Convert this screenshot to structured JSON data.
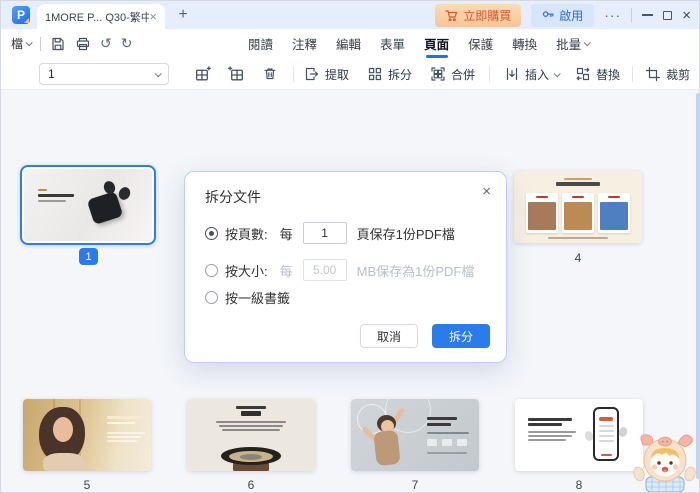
{
  "titlebar": {
    "tab_title": "1MORE P... Q30-繁中",
    "buy_label": "立即購買",
    "activate_label": "啟用"
  },
  "menubar": {
    "file_label": "檔",
    "tabs": [
      "閱讀",
      "注釋",
      "編輯",
      "表單",
      "頁面",
      "保護",
      "轉換",
      "批量"
    ],
    "active_tab": "頁面"
  },
  "toolbar": {
    "page_value": "1",
    "extract_label": "提取",
    "split_label": "拆分",
    "merge_label": "合併",
    "insert_label": "插入",
    "replace_label": "替換",
    "crop_label": "裁剪"
  },
  "dialog": {
    "title": "拆分文件",
    "option_pages": {
      "label": "按頁數:",
      "every": "每",
      "value": "1",
      "suffix": "頁保存1份PDF檔",
      "selected": true
    },
    "option_size": {
      "label": "按大小:",
      "every": "每",
      "value": "5.00",
      "suffix": "MB保存為1份PDF檔",
      "selected": false
    },
    "option_bookmark": {
      "label": "按一級書籤",
      "selected": false
    },
    "cancel_label": "取消",
    "confirm_label": "拆分"
  },
  "thumbnails": {
    "selected_page": "1",
    "page4": "4",
    "page5": "5",
    "page6": "6",
    "page7": "7",
    "page8": "8"
  },
  "glyphs": {
    "tab_close": "×",
    "new_tab": "+",
    "more": "···",
    "window_close": "×",
    "dialog_close": "×",
    "undo": "↺",
    "redo": "↻",
    "app_logo_letter": "P"
  },
  "colors": {
    "accent": "#2b7ceb",
    "titlebar_bg": "#e7eefb",
    "canvas_bg": "#f4f6f9",
    "buy_text": "#e0572b",
    "activate_text": "#2a6ee0"
  }
}
